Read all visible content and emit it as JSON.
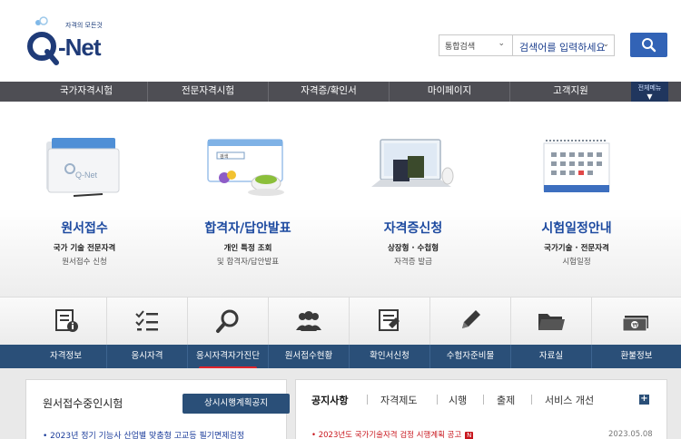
{
  "header": {
    "logo_tag": "자격의 모든것",
    "logo_name": "Q-Net",
    "search_scope": "통합검색",
    "search_placeholder": "검색어를 입력하세요"
  },
  "gnb": {
    "items": [
      "국가자격시험",
      "전문자격시험",
      "자격증/확인서",
      "마이페이지",
      "고객지원"
    ],
    "all_menu": "전체메뉴"
  },
  "hero": {
    "cards": [
      {
        "title": "원서접수",
        "sub1": "국가 기술 전문자격",
        "sub2": "원서접수 신청"
      },
      {
        "title": "합격자/답안발표",
        "sub1": "개인 특정 조회",
        "sub2": "및 합격자/답안발표"
      },
      {
        "title": "자격증신청",
        "sub1": "상장형 · 수첩형",
        "sub2": "자격증 발급"
      },
      {
        "title": "시험일정안내",
        "sub1": "국가기술 · 전문자격",
        "sub2": "시험일정"
      }
    ],
    "illus_badge_text": "검색"
  },
  "quick": {
    "labels": [
      "자격정보",
      "응시자격",
      "응시자격자가진단",
      "원서접수현황",
      "확인서신청",
      "수험자준비물",
      "자료실",
      "환불정보"
    ],
    "icons": [
      "info-document-icon",
      "checklist-icon",
      "magnifier-icon",
      "people-group-icon",
      "certificate-document-icon",
      "pencil-icon",
      "folder-icon",
      "money-icon"
    ]
  },
  "left_panel": {
    "title": "원서접수중인시험",
    "plan_button": "상시시행계획공지",
    "item": "2023년 정기 기능사 산업별 맞춤형 고교등 필기면제검정"
  },
  "right_panel": {
    "tabs": [
      "공지사항",
      "자격제도",
      "시행",
      "출제",
      "서비스 개선"
    ],
    "notice_title": "2023년도 국가기술자격 검정 시행계획 공고",
    "notice_badge": "N",
    "notice_date": "2023.05.08"
  },
  "colors": {
    "brand_blue": "#1f3b78",
    "search_button": "#3263b6",
    "gnb_bg": "#4e4e54",
    "quick_bar": "#2a4f78",
    "accent_red": "#e0232b"
  }
}
